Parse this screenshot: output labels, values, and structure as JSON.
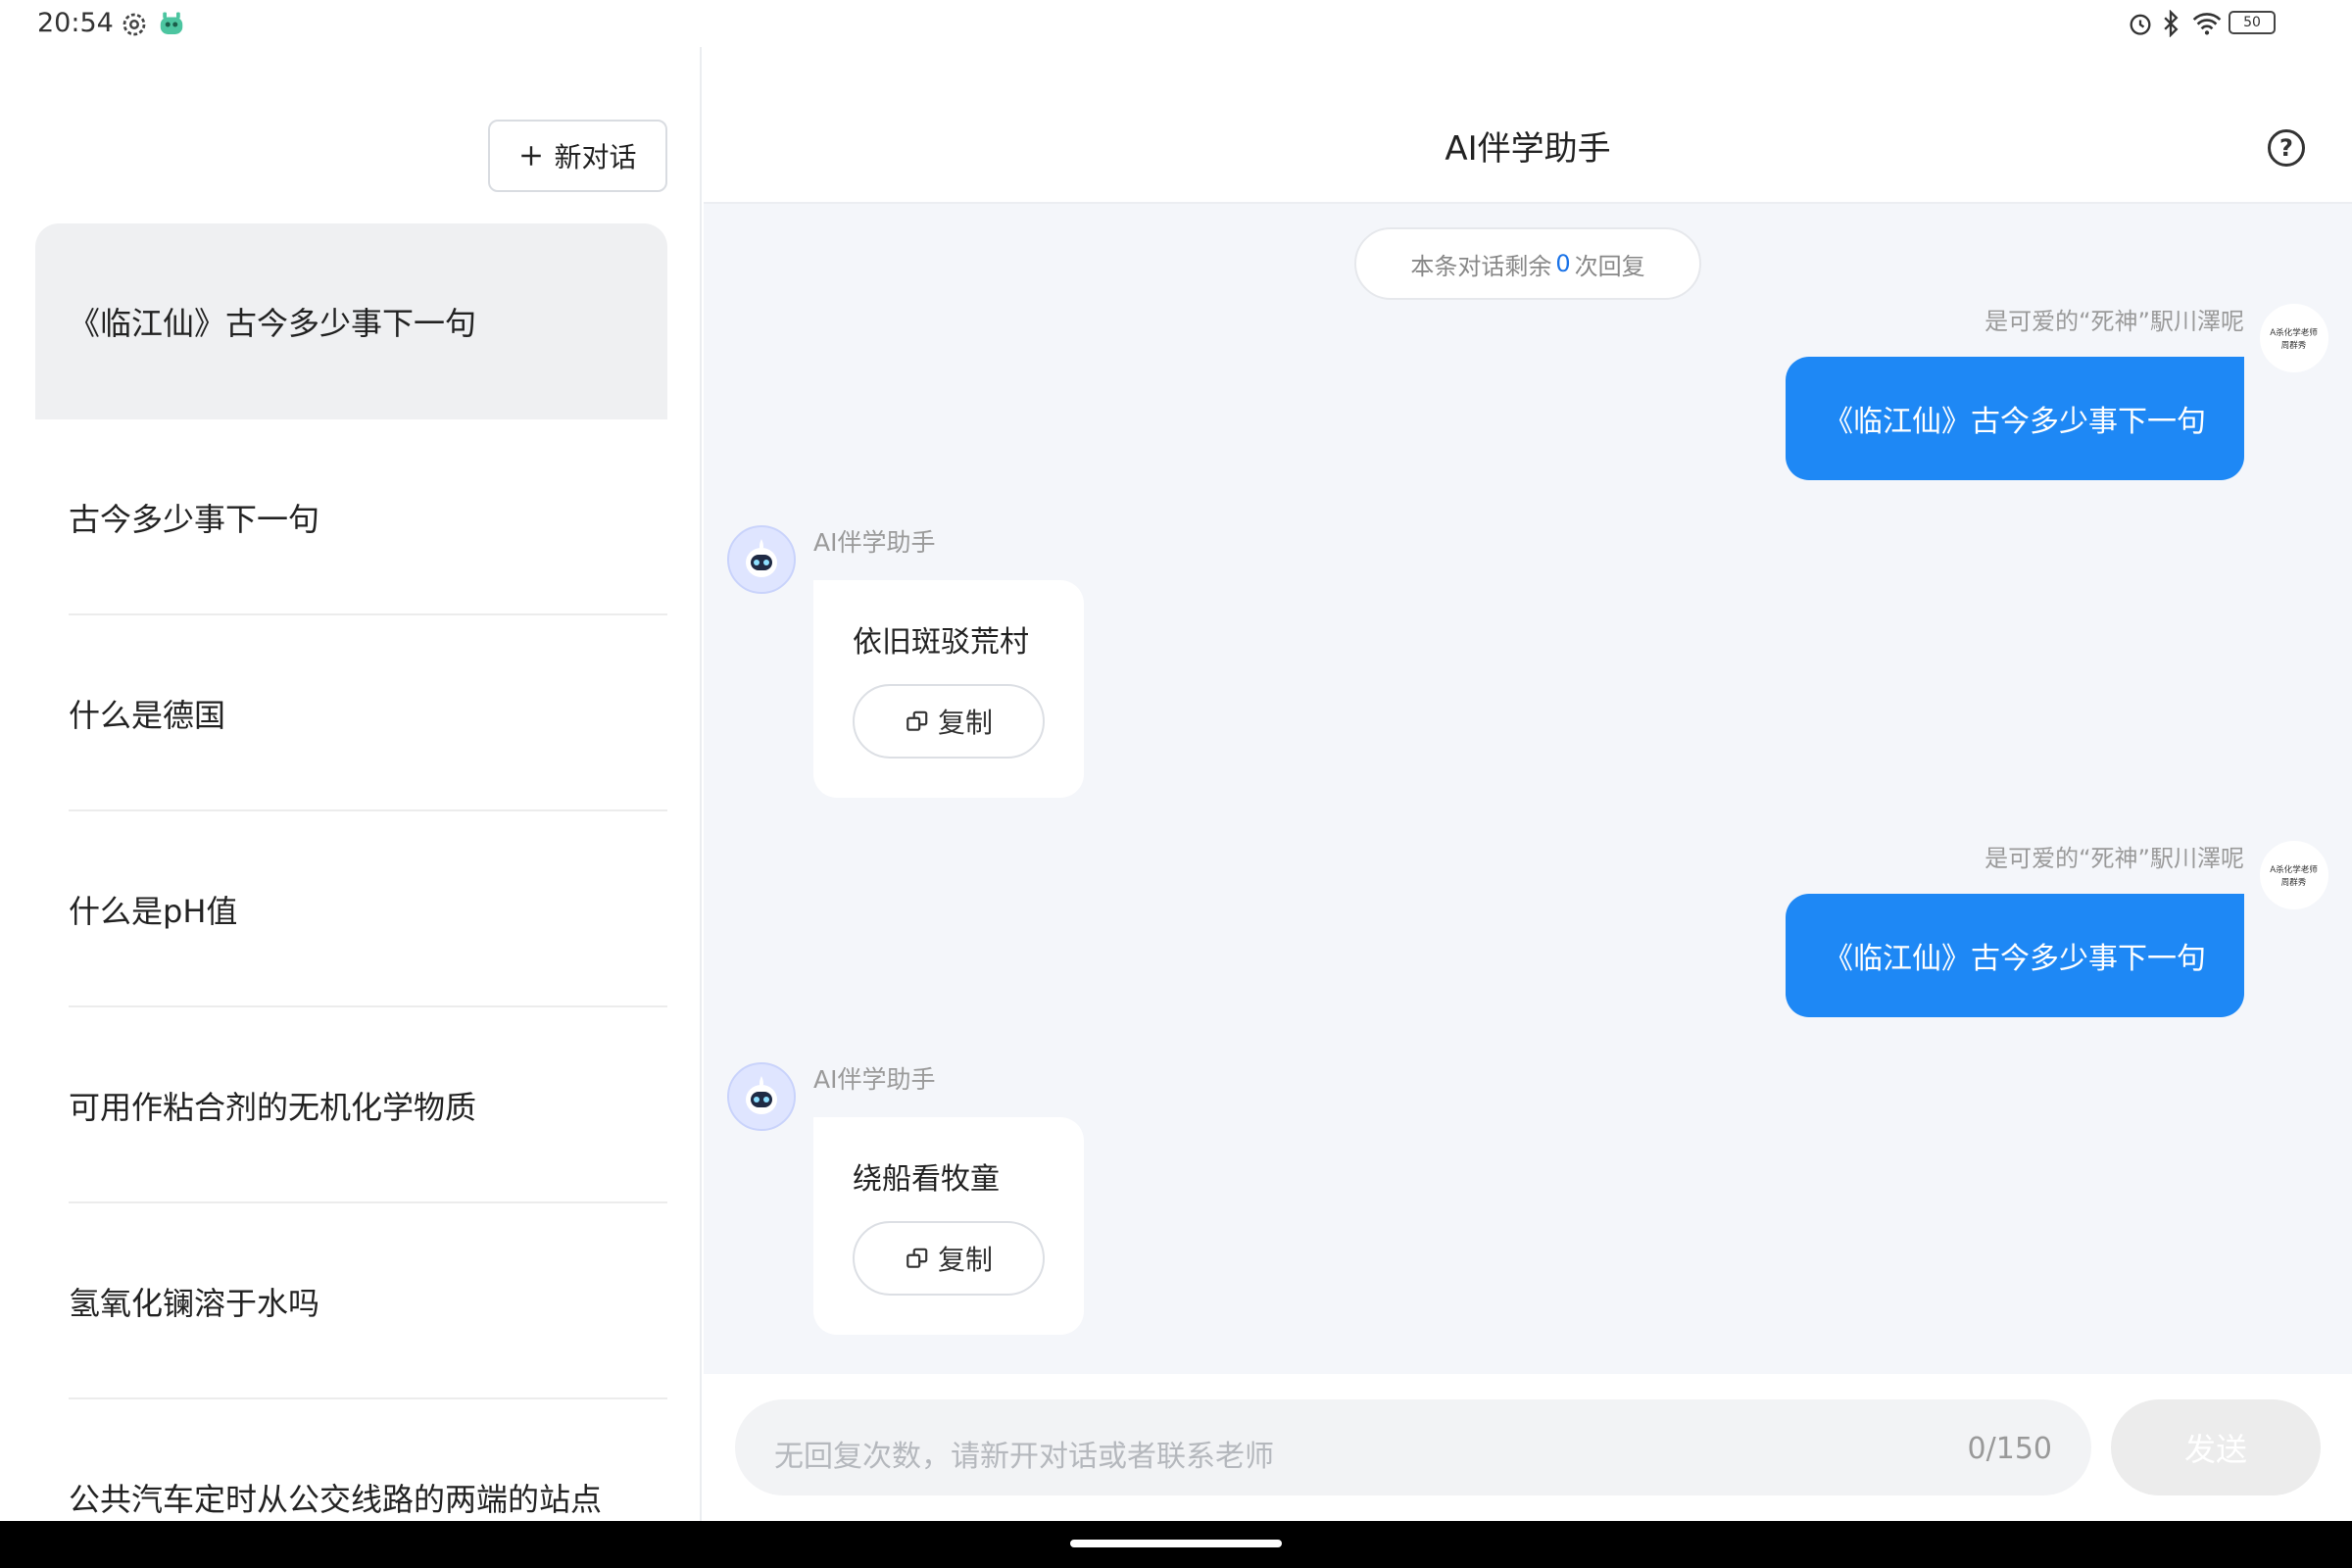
{
  "status_bar": {
    "time": "20:54",
    "battery": "50",
    "icons": [
      "settings-icon",
      "app-notification-icon",
      "alarm-icon",
      "bluetooth-icon",
      "wifi-icon",
      "battery-icon"
    ]
  },
  "sidebar": {
    "new_chat_label": "新对话",
    "history": [
      {
        "label": "《临江仙》古今多少事下一句",
        "active": true
      },
      {
        "label": "古今多少事下一句"
      },
      {
        "label": "什么是德国"
      },
      {
        "label": "什么是pH值"
      },
      {
        "label": "可用作粘合剂的无机化学物质"
      },
      {
        "label": "氢氧化镧溶于水吗"
      },
      {
        "label": "公共汽车定时从公交线路的两端的站点"
      }
    ]
  },
  "header": {
    "title": "AI伴学助手",
    "help_label": "?"
  },
  "chat": {
    "remaining": {
      "prefix": "本条对话剩余",
      "count": "0",
      "suffix": "次回复"
    },
    "user_avatar_text": [
      "A杀化学老师",
      "周群秀"
    ],
    "messages": [
      {
        "role": "user",
        "name": "是可爱的“死神”駅川澤呢",
        "text": "《临江仙》古今多少事下一句"
      },
      {
        "role": "assistant",
        "name": "AI伴学助手",
        "text": "依旧斑驳荒村",
        "copy_label": "复制"
      },
      {
        "role": "user",
        "name": "是可爱的“死神”駅川澤呢",
        "text": "《临江仙》古今多少事下一句"
      },
      {
        "role": "assistant",
        "name": "AI伴学助手",
        "text": "绕船看牧童",
        "copy_label": "复制"
      }
    ]
  },
  "composer": {
    "placeholder": "无回复次数，请新开对话或者联系老师",
    "counter": "0/150",
    "send_label": "发送"
  },
  "colors": {
    "accent": "#1e88f5",
    "remaining_count": "#1a73e8",
    "main_background": "#f4f6fa",
    "active_history": "#eff0f2"
  }
}
